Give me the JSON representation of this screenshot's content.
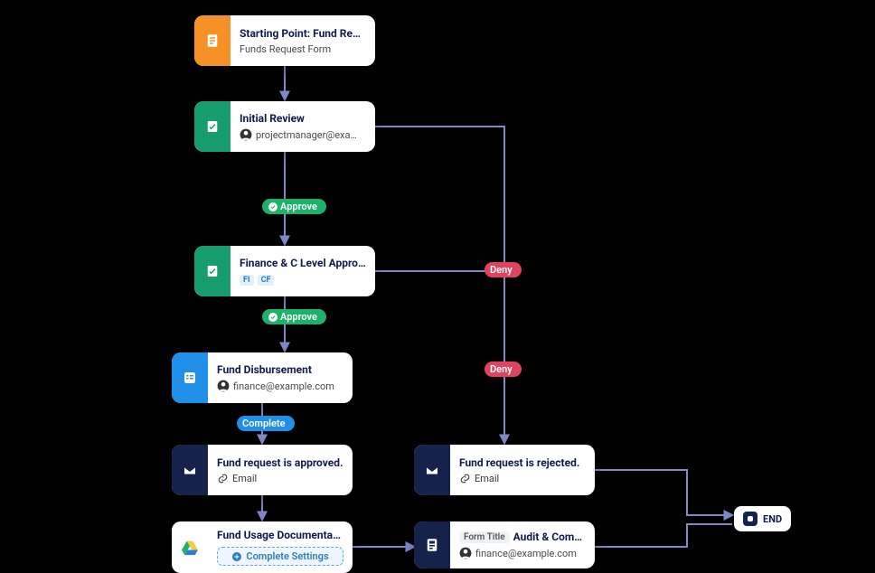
{
  "nodes": {
    "start": {
      "title": "Starting Point: Fund Request …",
      "sub": "Funds Request Form"
    },
    "review": {
      "title": "Initial Review",
      "user": "projectmanager@exa…"
    },
    "finance": {
      "title": "Finance & C Level Approve &…",
      "tags": [
        "FI",
        "CF"
      ]
    },
    "disburse": {
      "title": "Fund Disbursement",
      "user": "finance@example.com"
    },
    "approved": {
      "title": "Fund request is approved.",
      "link": "Email"
    },
    "rejected": {
      "title": "Fund request is rejected.",
      "link": "Email"
    },
    "usage": {
      "title": "Fund Usage Documentation",
      "button": "Complete Settings"
    },
    "audit": {
      "form_title_label": "Form Title",
      "title": "Audit & Compli…",
      "user": "finance@example.com"
    }
  },
  "decisions": {
    "approve1": "Approve",
    "approve2": "Approve",
    "complete": "Complete",
    "deny1": "Deny",
    "deny2": "Deny"
  },
  "end": {
    "label": "END"
  }
}
